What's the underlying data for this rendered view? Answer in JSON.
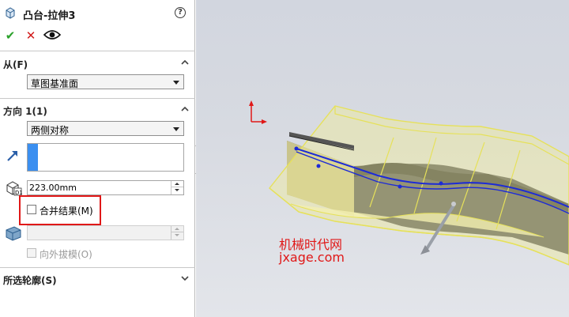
{
  "panel": {
    "title": "凸台-拉伸3",
    "help_glyph": "?",
    "actions": {
      "ok_glyph": "✔",
      "cancel_glyph": "✕"
    }
  },
  "from_section": {
    "label": "从(F)",
    "start_condition": "草图基准面"
  },
  "direction1": {
    "label": "方向 1(1)",
    "end_condition": "两侧对称",
    "depth_value": "223.00mm",
    "merge_result": {
      "label": "合并结果(M)",
      "checked": false
    },
    "draft_outward": {
      "label": "向外拔模(O)",
      "checked": false,
      "enabled": false
    }
  },
  "selected_contours": {
    "label": "所选轮廓(S)"
  },
  "watermark": {
    "line1": "机械时代网",
    "line2": "jxage.com"
  },
  "colors": {
    "accent_selection": "#3b8ff0",
    "highlight_frame": "#e01818",
    "preview_yellow": "#e6e15a",
    "sketch_blue": "#1d2bd6"
  },
  "icons": [
    "extrude-feature-icon",
    "help-icon",
    "ok-icon",
    "cancel-icon",
    "eye-icon",
    "chevron-up-icon",
    "chevron-down-icon",
    "direction-arrow-icon",
    "depth-icon",
    "draft-icon"
  ]
}
